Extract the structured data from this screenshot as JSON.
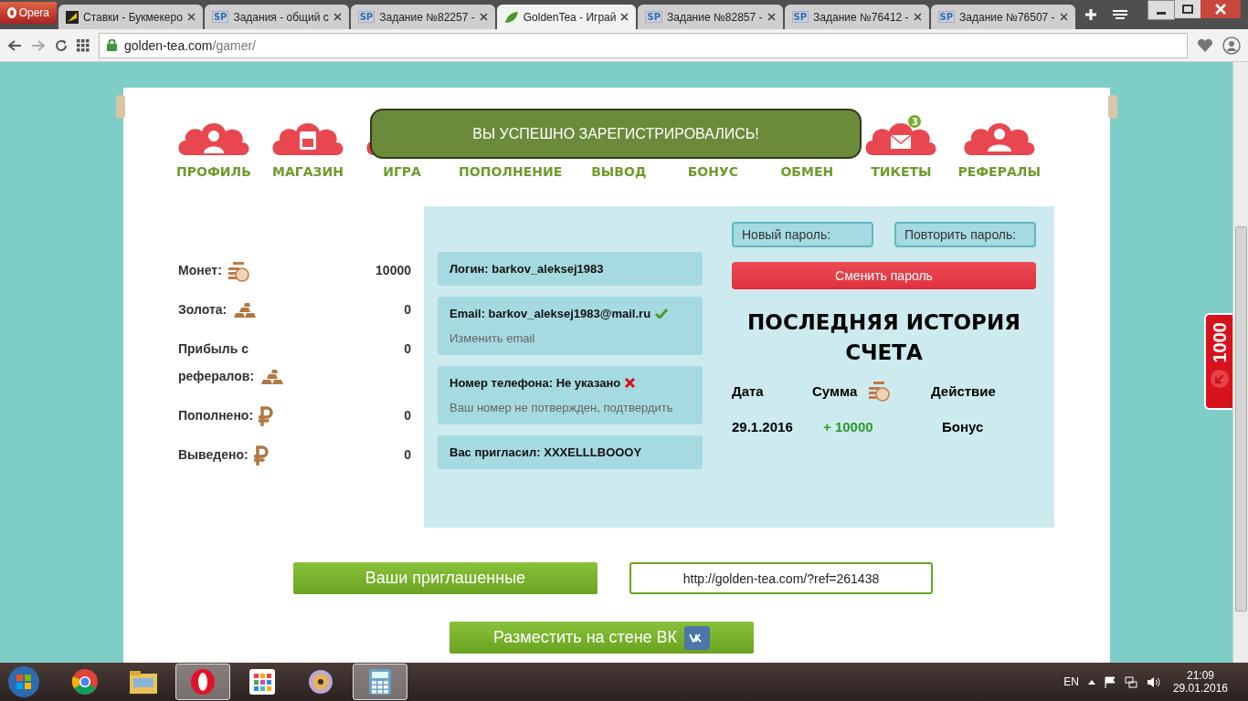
{
  "browser": {
    "menu_label": "Opera",
    "tabs": [
      {
        "title": "Ставки - Букмекеро",
        "kind": "square",
        "selected": false
      },
      {
        "title": "Задания - общий с",
        "kind": "lettered",
        "favicon": "SP",
        "selected": false
      },
      {
        "title": "Задание №82257 -",
        "kind": "lettered",
        "favicon": "SP",
        "selected": false
      },
      {
        "title": "GoldenTea - Играй",
        "kind": "leaf",
        "selected": true
      },
      {
        "title": "Задание №82857 -",
        "kind": "lettered",
        "favicon": "SP",
        "selected": false
      },
      {
        "title": "Задание №76412 -",
        "kind": "lettered",
        "favicon": "SP",
        "selected": false
      },
      {
        "title": "Задание №76507 -",
        "kind": "lettered",
        "favicon": "SP",
        "selected": false
      }
    ],
    "address": {
      "host": "golden-tea.com",
      "path": "/gamer/"
    }
  },
  "nav": [
    {
      "label": "ПРОФИЛЬ",
      "kind": "user"
    },
    {
      "label": "МАГАЗИН",
      "kind": "shop"
    },
    {
      "label": "ИГРА",
      "kind": "plain"
    },
    {
      "label": "ПОПОЛНЕНИЕ",
      "kind": "plain"
    },
    {
      "label": "ВЫВОД",
      "kind": "plain"
    },
    {
      "label": "БОНУС",
      "kind": "plain"
    },
    {
      "label": "ОБМЕН",
      "kind": "plain"
    },
    {
      "label": "ТИКЕТЫ",
      "kind": "mail",
      "badge": "3"
    },
    {
      "label": "РЕФЕРАЛЫ",
      "kind": "people"
    }
  ],
  "toast": "ВЫ УСПЕШНО ЗАРЕГИСТРИРОВАЛИСЬ!",
  "stats": [
    {
      "label": "Монет:",
      "kind": "coins",
      "value": "10000"
    },
    {
      "label": "Золота:",
      "kind": "bars",
      "value": "0"
    },
    {
      "label": "Прибыль с рефералов:",
      "kind": "bars",
      "value": "0"
    },
    {
      "label": "Пополнено:",
      "kind": "ruble",
      "value": "0"
    },
    {
      "label": "Выведено:",
      "kind": "ruble",
      "value": "0"
    }
  ],
  "account": [
    {
      "text": "Логин: barkov_aleksej1983"
    },
    {
      "text": "Email: barkov_aleksej1983@mail.ru",
      "verified": true,
      "link": "Изменить email"
    },
    {
      "text": "Номер телефона: Не указано",
      "verified": false,
      "link": "Ваш номер не потвержден, подтвердить"
    },
    {
      "text": "Вас пригласил: XXXELLLBOOOY"
    }
  ],
  "password": {
    "fields": [
      {
        "placeholder": "Новый пароль:"
      },
      {
        "placeholder": "Повторить пароль:"
      }
    ],
    "button": "Сменить пароль"
  },
  "history": {
    "title": "ПОСЛЕДНЯЯ ИСТОРИЯ СЧЕТА",
    "columns": [
      "Дата",
      "Сумма",
      "Действие"
    ],
    "rows": [
      {
        "date": "29.1.2016",
        "amount": "+ 10000",
        "action": "Бонус"
      }
    ]
  },
  "invited_button": "Ваши приглашенные",
  "ref_link": "http://golden-tea.com/?ref=261438",
  "vk_button": "Разместить на стене ВК",
  "side_tab": "1000",
  "taskbar": {
    "apps": [
      {
        "kind": "chrome",
        "selected": false
      },
      {
        "kind": "folder",
        "selected": false
      },
      {
        "kind": "opera",
        "selected": true
      },
      {
        "kind": "tiles",
        "selected": false
      },
      {
        "kind": "disc",
        "selected": false
      },
      {
        "kind": "calculator",
        "selected": true
      }
    ],
    "language": "EN",
    "time": "21:09",
    "date": "29.01.2016"
  }
}
